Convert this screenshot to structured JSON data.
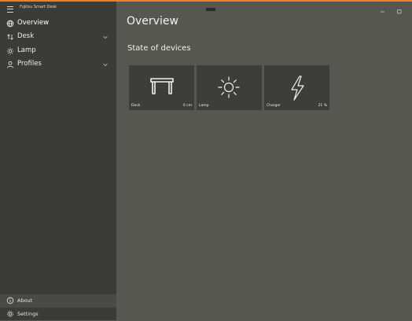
{
  "app": {
    "title": "Fujitsu Smart Desk"
  },
  "nav": {
    "items": [
      {
        "label": "Overview",
        "icon": "globe-icon",
        "expandable": false
      },
      {
        "label": "Desk",
        "icon": "height-arrows-icon",
        "expandable": true
      },
      {
        "label": "Lamp",
        "icon": "sun-icon",
        "expandable": false
      },
      {
        "label": "Profiles",
        "icon": "person-icon",
        "expandable": true
      }
    ],
    "bottom": [
      {
        "label": "About",
        "icon": "info-icon"
      },
      {
        "label": "Settings",
        "icon": "gear-icon"
      }
    ]
  },
  "main": {
    "title": "Overview",
    "section_title": "State of devices",
    "tiles": [
      {
        "name": "Desk",
        "value": "0 cm",
        "icon": "desk-icon"
      },
      {
        "name": "Lamp",
        "value": "",
        "icon": "sun-icon"
      },
      {
        "name": "Charger",
        "value": "21 %",
        "icon": "lightning-icon"
      }
    ]
  },
  "colors": {
    "accent": "#e8812a",
    "sidebar": "#3c3b35",
    "content": "#58574f",
    "tile": "#3e3d37"
  }
}
